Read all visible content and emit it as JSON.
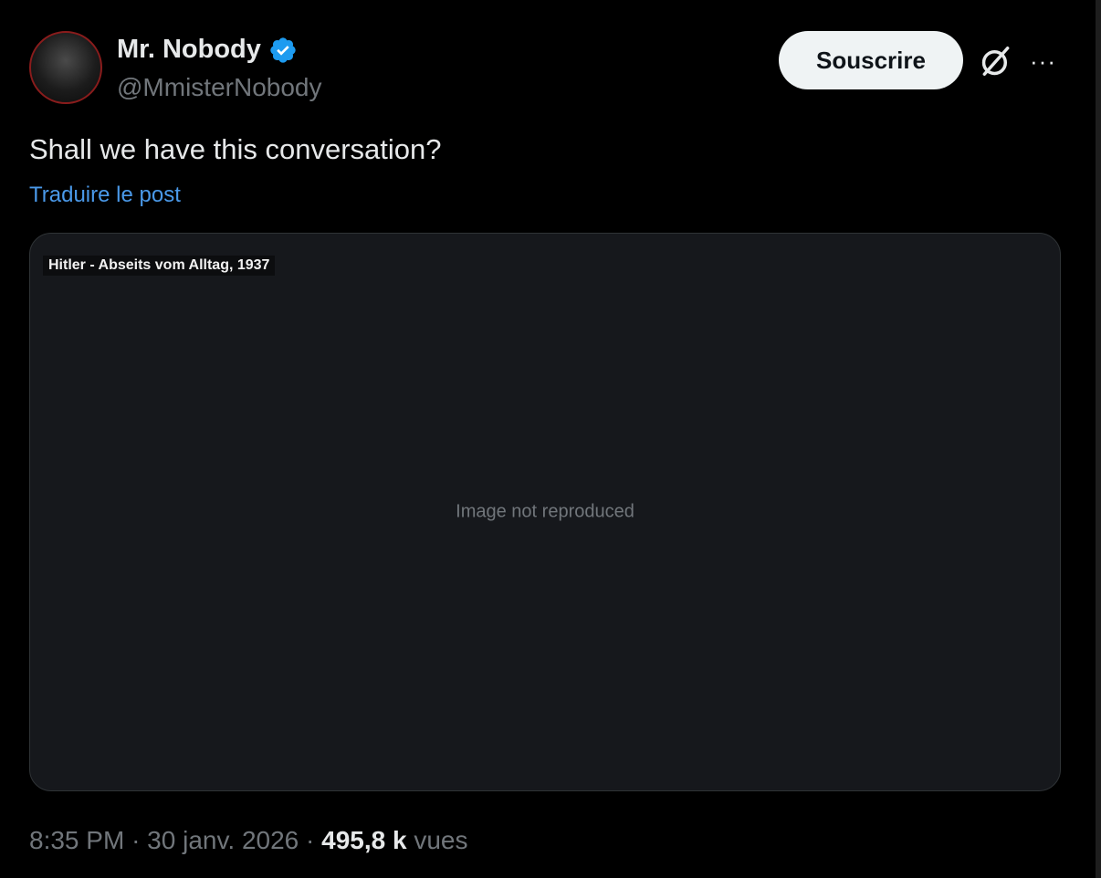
{
  "author": {
    "display_name": "Mr. Nobody",
    "handle": "@MmisterNobody",
    "verified_icon": "verified-badge-icon",
    "accent": "#1d9bf0"
  },
  "actions": {
    "subscribe_label": "Souscrire",
    "grok_icon": "grok-icon",
    "more_icon": "more-icon",
    "more_glyph": "···"
  },
  "post": {
    "text": "Shall we have this conversation?",
    "translate_label": "Traduire le post"
  },
  "media": {
    "caption": "Hitler - Abseits vom Alltag, 1937",
    "note": "Image not reproduced"
  },
  "meta": {
    "time": "8:35 PM",
    "separator": "·",
    "date": "30 janv. 2026",
    "views_count": "495,8 k",
    "views_label": "vues"
  }
}
